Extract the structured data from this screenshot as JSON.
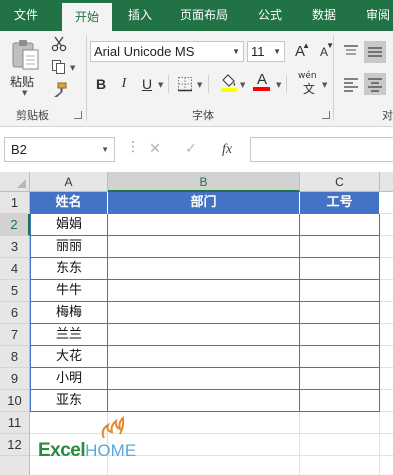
{
  "ribbon_tabs": [
    {
      "label": "文件",
      "active": false
    },
    {
      "label": "开始",
      "active": true
    },
    {
      "label": "插入",
      "active": false
    },
    {
      "label": "页面布局",
      "active": false
    },
    {
      "label": "公式",
      "active": false
    },
    {
      "label": "数据",
      "active": false
    },
    {
      "label": "审阅",
      "active": false
    }
  ],
  "clipboard": {
    "paste_label": "粘贴",
    "group_label": "剪贴板",
    "icons": [
      "paste-icon",
      "cut-icon",
      "copy-icon",
      "format-painter-icon"
    ]
  },
  "font": {
    "name": "Arial Unicode MS",
    "size": "11",
    "bold_label": "B",
    "italic_label": "I",
    "underline_label": "U",
    "grow_label": "A",
    "shrink_label": "A",
    "color_label": "A",
    "phonetic_label": "wén",
    "group_label": "字体",
    "fill_color": "#ffff00",
    "font_color": "#ff0000"
  },
  "alignment": {
    "group_label": "对"
  },
  "formula_bar": {
    "name_box": "B2",
    "cancel_label": "✕",
    "enter_label": "✓",
    "fx_label": "fx",
    "formula": ""
  },
  "sheet": {
    "columns": [
      "A",
      "B",
      "C"
    ],
    "selected_column": "B",
    "rows": [
      "1",
      "2",
      "3",
      "4",
      "5",
      "6",
      "7",
      "8",
      "9",
      "10",
      "11",
      "12"
    ],
    "selected_row": "2",
    "headers": [
      "姓名",
      "部门",
      "工号"
    ],
    "names": [
      "娟娟",
      "丽丽",
      "东东",
      "牛牛",
      "梅梅",
      "兰兰",
      "大花",
      "小明",
      "亚东"
    ],
    "header_fill": "#4472c4",
    "border_color": "#4472c4"
  },
  "logo": {
    "part1": "Excel",
    "part2": "HOME"
  },
  "theme": {
    "accent": "#217346"
  }
}
